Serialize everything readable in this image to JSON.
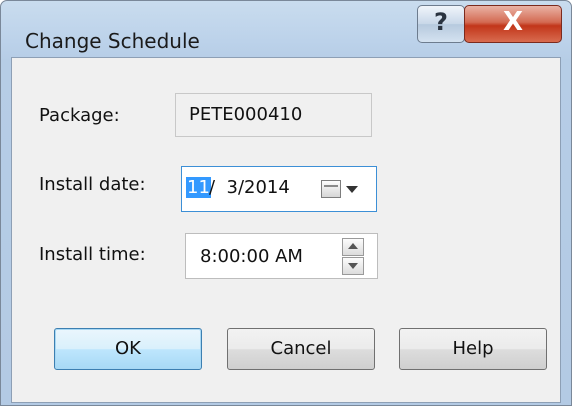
{
  "window": {
    "title": "Change Schedule",
    "help_glyph": "?",
    "close_glyph": "X"
  },
  "form": {
    "package_label": "Package:",
    "package_value": "PETE000410",
    "install_date_label": "Install date:",
    "install_date_month": "11",
    "install_date_rest": "/  3/2014",
    "install_time_label": "Install time:",
    "install_time_value": "8:00:00 AM"
  },
  "buttons": {
    "ok": "OK",
    "cancel": "Cancel",
    "help": "Help"
  },
  "colors": {
    "selection": "#3399ff",
    "close_button": "#c2361a",
    "window_frame": "#b6cde6"
  },
  "icons": [
    "calendar-icon",
    "dropdown-arrow-icon",
    "spin-up-icon",
    "spin-down-icon",
    "help-icon",
    "close-icon"
  ]
}
